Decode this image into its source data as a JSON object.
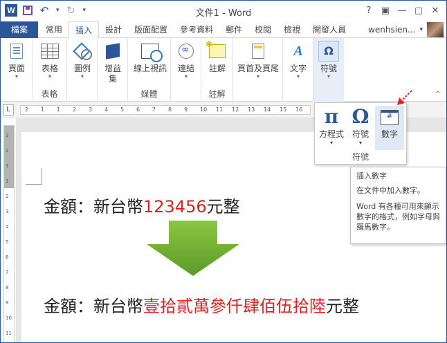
{
  "window": {
    "title": "文件1 - Word",
    "help": "?",
    "ribbon_display": "▣",
    "minimize": "—",
    "restore": "▢",
    "close": "✕"
  },
  "qat": {
    "app_icon": "W",
    "undo": "↶",
    "undo_dd": "▾",
    "redo": "↻",
    "more": "▾"
  },
  "tabs": {
    "file": "檔案",
    "items": [
      "常用",
      "插入",
      "設計",
      "版面配置",
      "參考資料",
      "郵件",
      "校閱",
      "檢視",
      "開發人員"
    ],
    "active_index": 1
  },
  "user": {
    "name": "wenhsien...",
    "caret": "▾"
  },
  "ribbon": {
    "page": "頁面",
    "table": "表格",
    "table_group": "表格",
    "illustration": "圖例",
    "addins": "增益",
    "addins2": "集",
    "online_video": "線上視訊",
    "media_group": "媒體",
    "links": "連結",
    "comment": "註解",
    "comment_group": "註解",
    "header_footer": "頁首及頁尾",
    "text": "文字",
    "symbols": "符號",
    "collapse": "^"
  },
  "symbol_panel": {
    "equation_glyph": "π",
    "equation": "方程式",
    "symbol_glyph": "Ω",
    "symbol": "符號",
    "number_glyph": "#",
    "number": "數字",
    "group": "符號"
  },
  "tooltip": {
    "title": "插入數字",
    "line1": "在文件中加入數字。",
    "line2": "Word 有各種可用來顯示數字的格式，例如字母與羅馬數字。"
  },
  "ruler": {
    "tab_selector": "L",
    "marks": [
      "2",
      "1",
      "1",
      "2",
      "3",
      "4",
      "5",
      "6",
      "7",
      "8",
      "9",
      "10",
      "11",
      "12",
      "13",
      "14",
      "15",
      "16"
    ],
    "vmarks": [
      "3",
      "2",
      "1",
      "1",
      "2",
      "3",
      "4",
      "5",
      "6",
      "7",
      "8",
      "9",
      "10",
      "11"
    ]
  },
  "document": {
    "label": "金額：新台幣",
    "number": "123456",
    "suffix": "元整",
    "label2": "金額：新台幣",
    "chinese_number": "壹拾貳萬參仟肆佰伍拾陸",
    "suffix2": "元整"
  },
  "colors": {
    "accent": "#2b579a",
    "highlight_red": "#e02020",
    "arrow_green": "#6aa832"
  }
}
